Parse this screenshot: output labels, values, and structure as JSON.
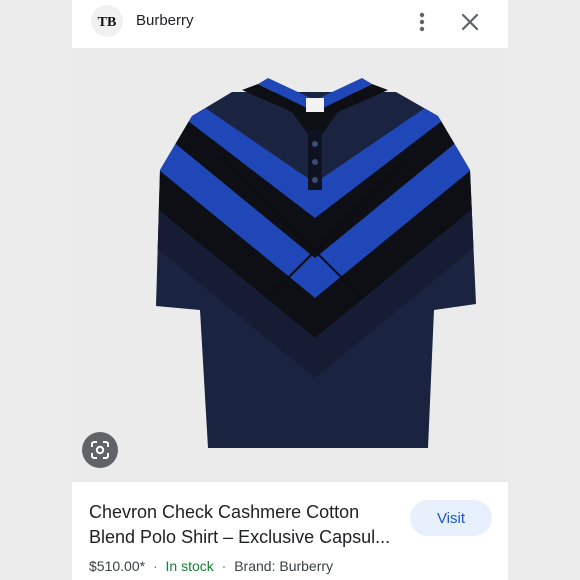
{
  "header": {
    "brand": "Burberry",
    "logo_letters": "TB"
  },
  "product": {
    "title_line1": "Chevron Check Cashmere Cotton",
    "title_line2": "Blend Polo Shirt – Exclusive Capsul...",
    "price": "$510.00*",
    "separator": "·",
    "stock": "In stock",
    "brand_label": "Brand: Burberry"
  },
  "actions": {
    "visit_label": "Visit"
  },
  "icons": {
    "more": "more-vert-icon",
    "close": "close-icon",
    "lens": "google-lens-icon"
  },
  "colors": {
    "navy": "#1a2340",
    "royal_blue": "#1f47b8",
    "black": "#0d0f14",
    "stock_green": "#188038",
    "visit_bg": "#e8f0fe",
    "visit_text": "#1a56c4"
  }
}
